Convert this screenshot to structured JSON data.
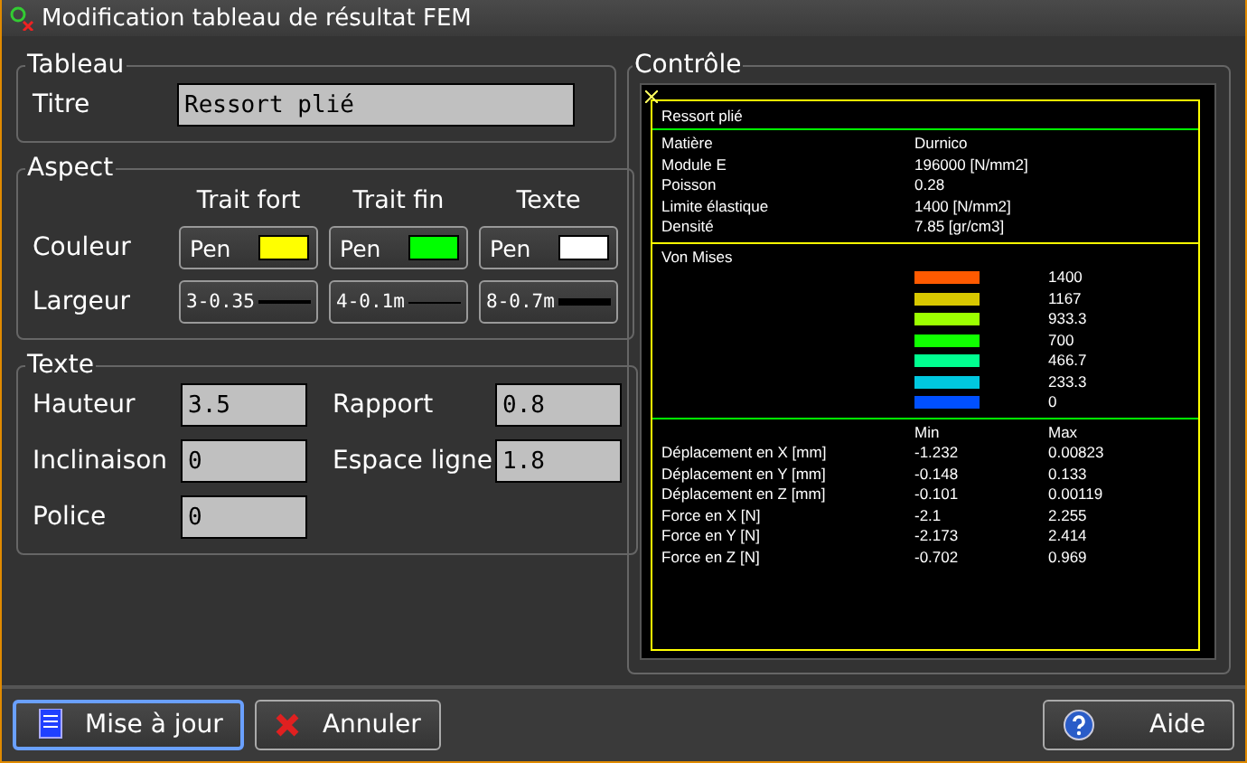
{
  "window": {
    "title": "Modification tableau de résultat FEM"
  },
  "tableau": {
    "legend": "Tableau",
    "label": "Titre",
    "value": "Ressort plié"
  },
  "aspect": {
    "legend": "Aspect",
    "columns": [
      "Trait fort",
      "Trait fin",
      "Texte"
    ],
    "color_label": "Couleur",
    "pens": [
      {
        "label": "Pen",
        "color": "#ffff00"
      },
      {
        "label": "Pen",
        "color": "#00ff00"
      },
      {
        "label": "Pen",
        "color": "#ffffff"
      }
    ],
    "width_label": "Largeur",
    "widths": [
      {
        "label": "3-0.35",
        "kind": "medium"
      },
      {
        "label": "4-0.1m",
        "kind": "thin"
      },
      {
        "label": "8-0.7m",
        "kind": "thick"
      }
    ]
  },
  "texte": {
    "legend": "Texte",
    "fields": [
      {
        "label": "Hauteur",
        "value": "3.5"
      },
      {
        "label": "Rapport",
        "value": "0.8"
      },
      {
        "label": "Inclinaison",
        "value": "0"
      },
      {
        "label": "Espace ligne",
        "value": "1.8"
      },
      {
        "label": "Police",
        "value": "0"
      }
    ]
  },
  "controle": {
    "legend": "Contrôle",
    "title": "Ressort plié",
    "properties": [
      {
        "name": "Matière",
        "value": "Durnico"
      },
      {
        "name": "Module E",
        "value": "196000 [N/mm2]"
      },
      {
        "name": "Poisson",
        "value": "0.28"
      },
      {
        "name": "Limite élastique",
        "value": "1400 [N/mm2]"
      },
      {
        "name": "Densité",
        "value": "7.85 [gr/cm3]"
      }
    ],
    "scale_title": "Von Mises",
    "scale": [
      {
        "value": "1400",
        "color": "#ff5a00"
      },
      {
        "value": "1167",
        "color": "#d8c800"
      },
      {
        "value": "933.3",
        "color": "#9cff00"
      },
      {
        "value": "700",
        "color": "#10ff00"
      },
      {
        "value": "466.7",
        "color": "#00ff90"
      },
      {
        "value": "233.3",
        "color": "#00c8e0"
      },
      {
        "value": "0",
        "color": "#0050ff"
      }
    ],
    "results_header": [
      "Min",
      "Max"
    ],
    "results": [
      {
        "name": "Déplacement en X [mm]",
        "min": "-1.232",
        "max": "0.00823"
      },
      {
        "name": "Déplacement en Y [mm]",
        "min": "-0.148",
        "max": "0.133"
      },
      {
        "name": "Déplacement en Z [mm]",
        "min": "-0.101",
        "max": "0.00119"
      },
      {
        "name": "Force en X [N]",
        "min": "-2.1",
        "max": "2.255"
      },
      {
        "name": "Force en Y [N]",
        "min": "-2.173",
        "max": "2.414"
      },
      {
        "name": "Force en Z [N]",
        "min": "-0.702",
        "max": "0.969"
      }
    ]
  },
  "buttons": [
    {
      "label": "Mise à jour",
      "kind": "update",
      "focused": true
    },
    {
      "label": "Annuler",
      "kind": "cancel",
      "focused": false
    },
    {
      "label": "Aide",
      "kind": "help",
      "focused": false
    }
  ]
}
